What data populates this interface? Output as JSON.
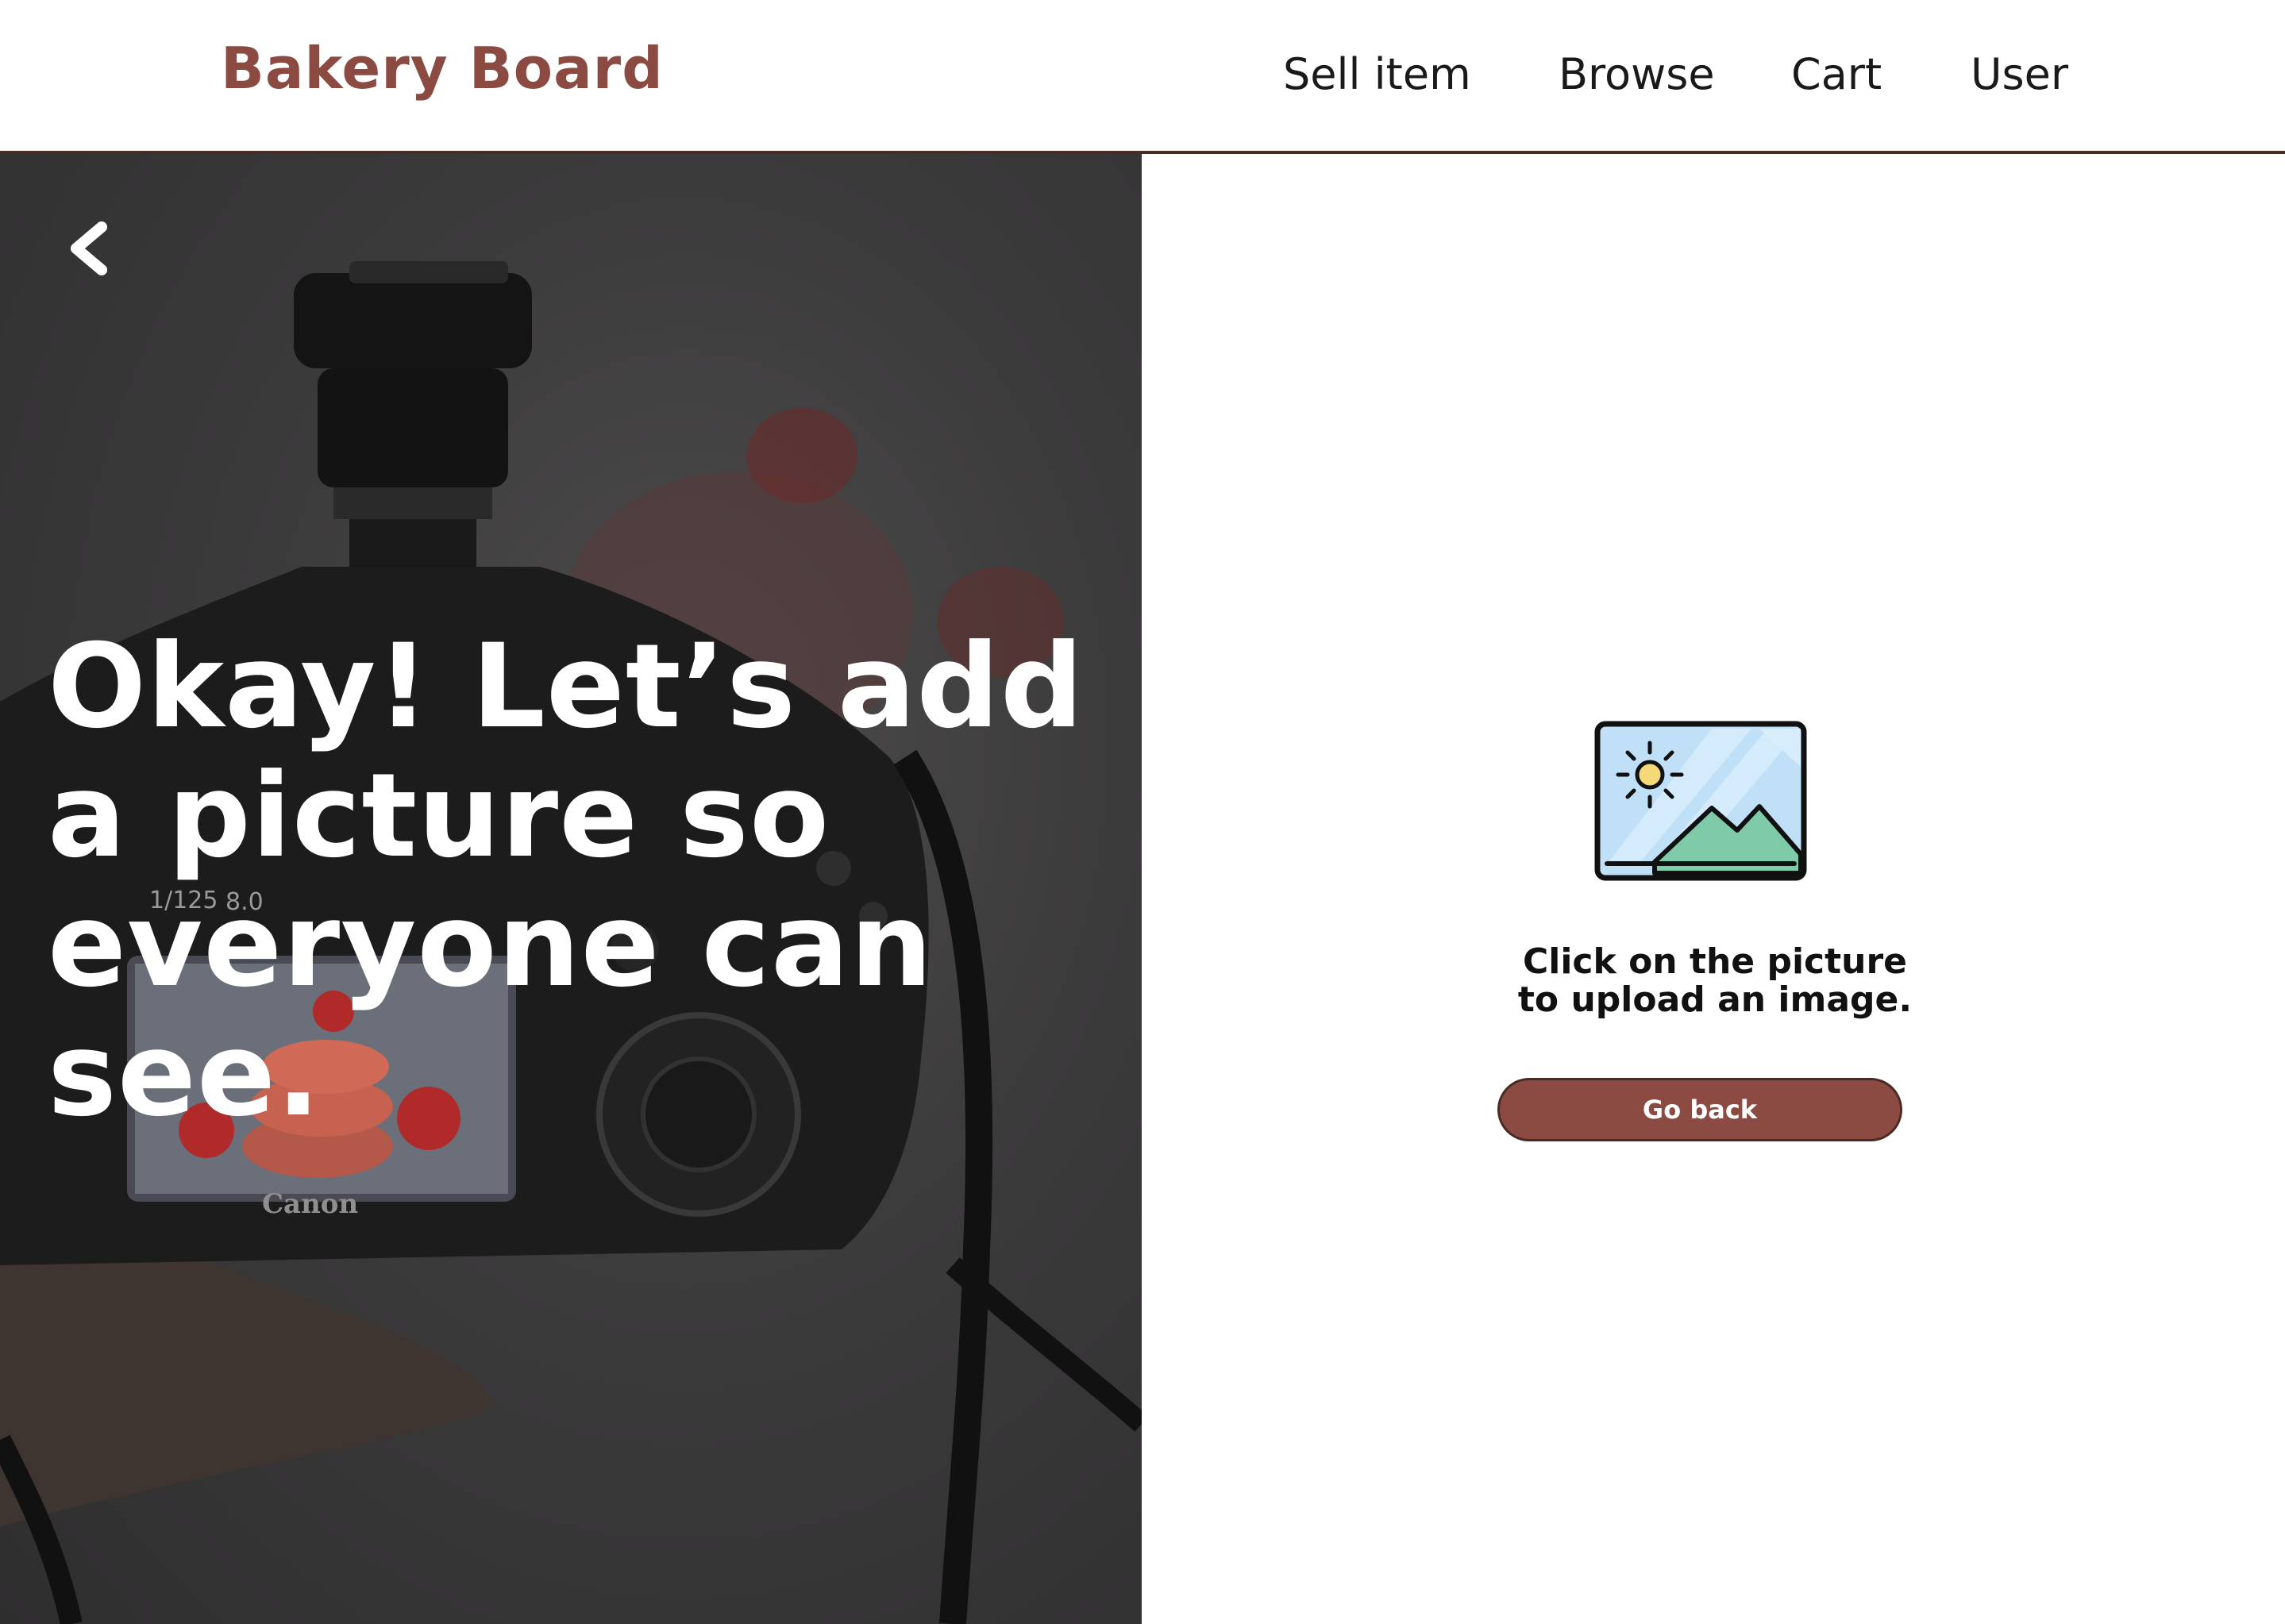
{
  "header": {
    "brand": "Bakery Board",
    "nav": {
      "sell": "Sell item",
      "browse": "Browse",
      "cart": "Cart",
      "user": "User"
    }
  },
  "hero": {
    "heading": "Okay!  Let’s add a picture so everyone can see.",
    "camera_brand": "Canon",
    "camera_readouts": [
      "1/125",
      "8.0"
    ]
  },
  "upload": {
    "line1": "Click on the picture",
    "line2": "to upload an image.",
    "go_back_label": "Go back"
  },
  "colors": {
    "brand": "#8c4b42",
    "button_border": "#4a2a24",
    "hero_overlay": "#3c3b3c"
  },
  "icons": {
    "back": "chevron-left-icon",
    "upload": "image-placeholder-icon"
  }
}
